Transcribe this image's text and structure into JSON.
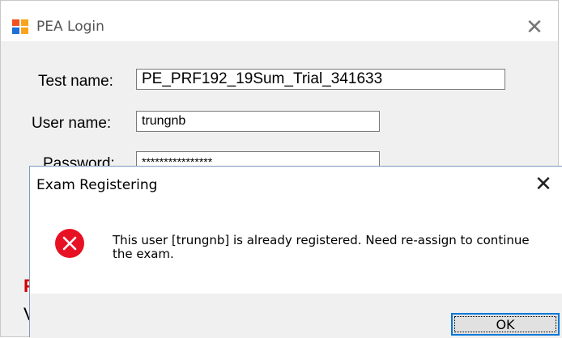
{
  "login_window": {
    "title": "PEA Login",
    "close_glyph": "✕",
    "icon": "app-window-icon",
    "fields": {
      "test_name": {
        "label": "Test name:",
        "value": "PE_PRF192_19Sum_Trial_341633"
      },
      "user_name": {
        "label": "User name:",
        "value": "trungnb"
      },
      "password": {
        "label": "Password:",
        "value": "****************"
      }
    },
    "partial_red_text": "F",
    "partial_text": "V"
  },
  "dialog": {
    "title": "Exam Registering",
    "close_glyph": "✕",
    "icon": "error-icon",
    "message": "This user [trungnb] is already registered. Need re-assign to continue the exam.",
    "ok_label": "OK"
  },
  "colors": {
    "error_red": "#e81123",
    "focus_blue": "#0078d7",
    "label_red": "#d40000"
  }
}
